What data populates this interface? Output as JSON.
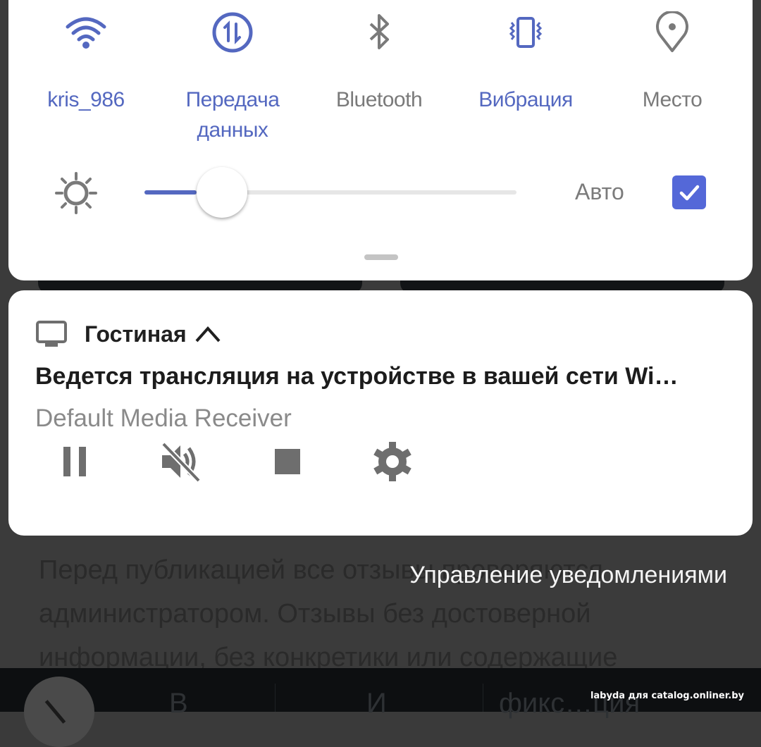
{
  "colors": {
    "accent": "#5468c0",
    "checkbox": "#5468d8",
    "inactive": "#7a7a7a",
    "panel": "#ffffff",
    "scrim": "#3b3b3b"
  },
  "quick_settings": {
    "tiles": [
      {
        "label": "kris_986",
        "icon": "wifi-icon",
        "state": "on"
      },
      {
        "label": "Передача данных",
        "icon": "mobile-data-icon",
        "state": "on"
      },
      {
        "label": "Bluetooth",
        "icon": "bluetooth-icon",
        "state": "off"
      },
      {
        "label": "Вибрация",
        "icon": "vibrate-icon",
        "state": "on"
      },
      {
        "label": "Место",
        "icon": "location-icon",
        "state": "off"
      }
    ],
    "brightness": {
      "icon": "brightness-icon",
      "value_percent": 14,
      "auto_label": "Авто",
      "auto_checked": true
    }
  },
  "notification": {
    "app_label": "Гостиная",
    "app_icon": "tv-icon",
    "expanded": true,
    "title": "Ведется трансляция на устройстве в вашей сети Wi…",
    "subtitle": "Default Media Receiver",
    "actions": [
      {
        "name": "pause",
        "icon": "pause-icon"
      },
      {
        "name": "mute",
        "icon": "volume-off-icon"
      },
      {
        "name": "stop",
        "icon": "stop-icon"
      },
      {
        "name": "settings",
        "icon": "gear-icon"
      }
    ]
  },
  "manage_notifications_label": "Управление уведомлениями",
  "background": {
    "text": "Перед публикацией все отзывы проверяются администратором. Отзывы без достоверной информации, без конкретики или содержащие",
    "tabs": [
      "В",
      "И",
      "фикс…ция"
    ],
    "watermark": "labyda для catalog.onliner.by"
  }
}
